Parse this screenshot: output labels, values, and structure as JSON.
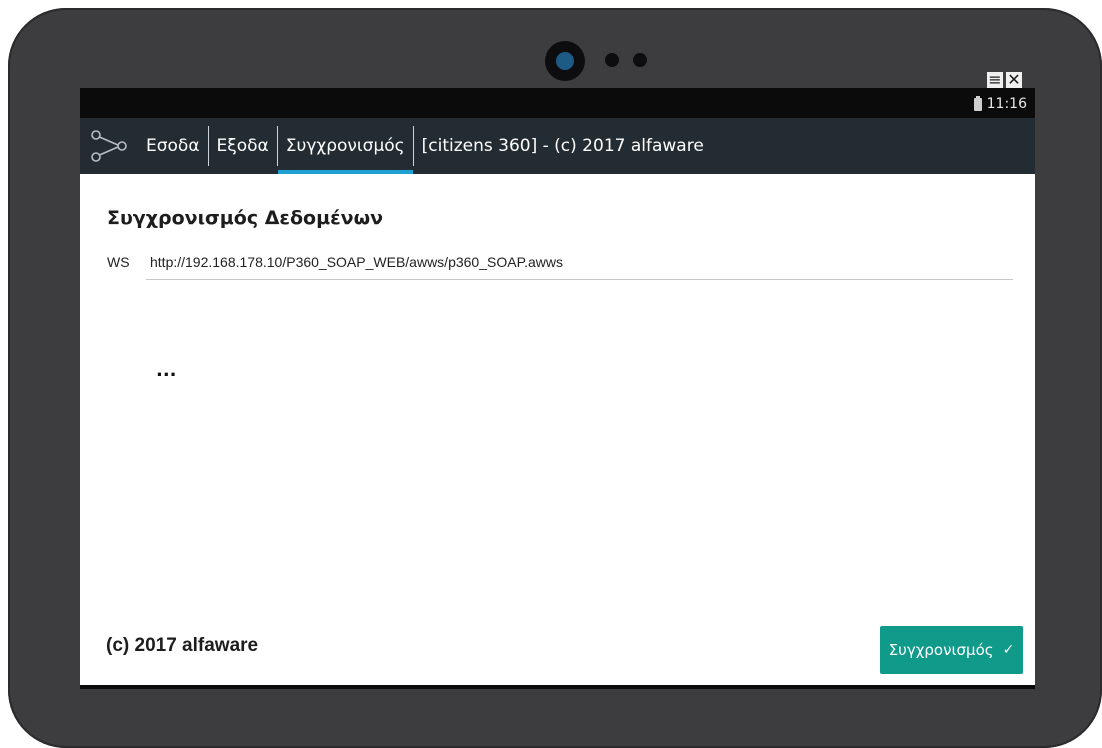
{
  "status_bar": {
    "time": "11:16",
    "battery_icon": "battery-icon"
  },
  "emulator_controls": {
    "menu_glyph": "≡",
    "close_glyph": "✕"
  },
  "app_bar": {
    "icon": "share-nodes-icon",
    "tabs": [
      {
        "label": "Εσοδα",
        "active": false
      },
      {
        "label": "Εξοδα",
        "active": false
      },
      {
        "label": "Συγχρονισμός",
        "active": true
      }
    ],
    "title": "[citizens 360] - (c) 2017 alfaware",
    "accent_color": "#1ea0d3",
    "background_color": "#242c33"
  },
  "main": {
    "section_title": "Συγχρονισμός Δεδομένων",
    "ws_label": "WS",
    "ws_value": "http://192.168.178.10/P360_SOAP_WEB/awws/p360_SOAP.awws",
    "status_text": "...",
    "footer_text": "(c) 2017 alfaware",
    "sync_button": {
      "label": "Συγχρονισμός",
      "icon": "check-icon",
      "color": "#109a8a"
    }
  }
}
